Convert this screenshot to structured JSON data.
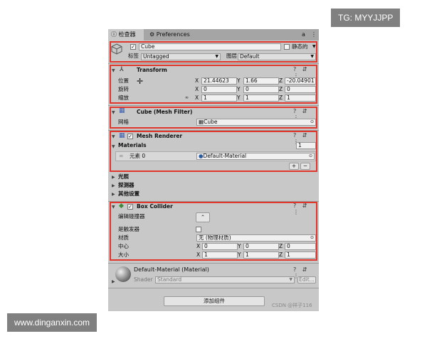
{
  "tabs": {
    "inspector": "检查器",
    "preferences": "Preferences"
  },
  "object": {
    "name": "Cube",
    "static_label": "静态的",
    "tag_label": "标签",
    "tag_value": "Untagged",
    "layer_label": "图层",
    "layer_value": "Default"
  },
  "transform": {
    "title": "Transform",
    "position_label": "位置",
    "rotation_label": "旋转",
    "scale_label": "缩放",
    "position": {
      "x": "21.44623",
      "y": "1.66",
      "z": "-20.04901"
    },
    "rotation": {
      "x": "0",
      "y": "0",
      "z": "0"
    },
    "scale": {
      "x": "1",
      "y": "1",
      "z": "1"
    }
  },
  "axis": {
    "x": "X",
    "y": "Y",
    "z": "Z"
  },
  "mesh_filter": {
    "title": "Cube (Mesh Filter)",
    "mesh_label": "网格",
    "mesh_value": "Cube"
  },
  "mesh_renderer": {
    "title": "Mesh Renderer",
    "materials_label": "Materials",
    "materials_count": "1",
    "element_label": "元素 0",
    "element_value": "Default-Material",
    "add": "+",
    "remove": "−"
  },
  "collapsed_sections": {
    "lighting": "光照",
    "probes": "探测器",
    "other": "其他设置"
  },
  "box_collider": {
    "title": "Box Collider",
    "edit_label": "编辑碰撞器",
    "trigger_label": "是触发器",
    "material_label": "材质",
    "material_value": "无 (物理材质)",
    "center_label": "中心",
    "size_label": "大小",
    "center": {
      "x": "0",
      "y": "0",
      "z": "0"
    },
    "size": {
      "x": "1",
      "y": "1",
      "z": "1"
    }
  },
  "material_asset": {
    "title": "Default-Material (Material)",
    "shader_label": "Shader",
    "shader_value": "Standard",
    "edit": "Edit..."
  },
  "add_component": "添加组件",
  "footer_watermark": "CSDN @祥子116",
  "watermarks": {
    "top_right": "TG: MYYJJPP",
    "bottom_left": "www.dinganxin.com"
  },
  "colors": {
    "highlight": "#e0362b",
    "panel_bg": "#c8c8c8"
  }
}
